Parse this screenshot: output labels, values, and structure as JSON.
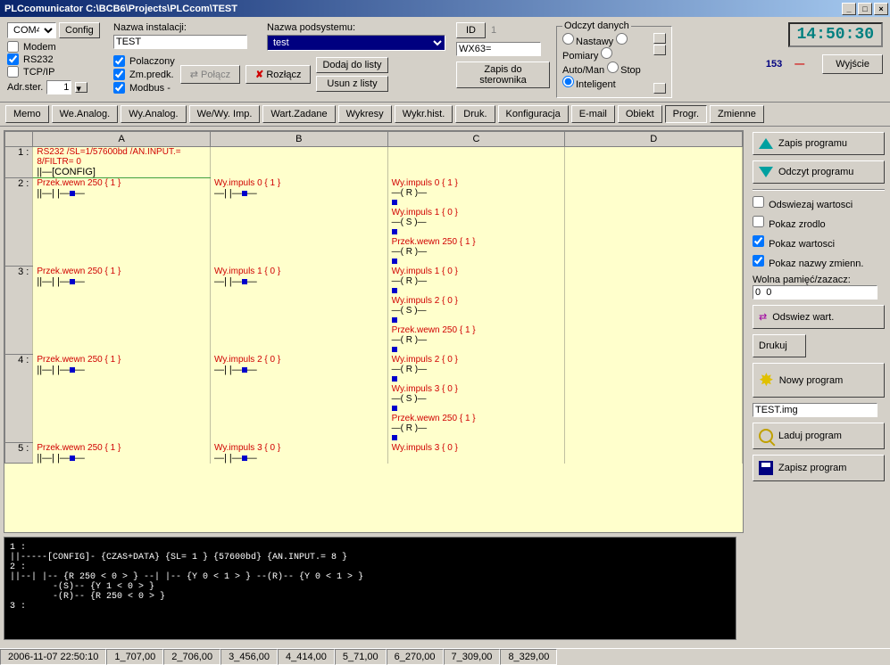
{
  "titlebar": {
    "title": "PLCcomunicator  C:\\BCB6\\Projects\\PLCcom\\TEST"
  },
  "port": {
    "value": "COM4",
    "config_btn": "Config"
  },
  "conn": {
    "modem": "Modem",
    "rs232": "RS232",
    "tcpip": "TCP/IP",
    "adr": "Adr.ster.",
    "adr_val": "1"
  },
  "install": {
    "label": "Nazwa instalacji:",
    "value": "TEST"
  },
  "subsys": {
    "label": "Nazwa podsystemu:",
    "value": "test"
  },
  "mid": {
    "polaczony": "Polaczony",
    "zmpredk": "Zm.predk.",
    "modbus": "Modbus -",
    "polacz": "Połącz",
    "rozlacz": "Rozłącz",
    "dodaj": "Dodaj do listy",
    "usun": "Usun z listy"
  },
  "idblock": {
    "id": "ID",
    "idval": "1",
    "wx": "WX63=",
    "zapis": "Zapis do sterownika"
  },
  "odczyt": {
    "legend": "Odczyt danych",
    "nastawy": "Nastawy",
    "pomiary": "Pomiary",
    "automan": "Auto/Man",
    "stop": "Stop",
    "inteligent": "Inteligent"
  },
  "topright": {
    "clock": "14:50:30",
    "num": "153",
    "dash": "—",
    "wyjscie": "Wyjście"
  },
  "tabs": [
    "Memo",
    "We.Analog.",
    "Wy.Analog.",
    "We/Wy. Imp.",
    "Wart.Zadane",
    "Wykresy",
    "Wykr.hist.",
    "Druk.",
    "Konfiguracja",
    "E-mail",
    "Obiekt",
    "Progr.",
    "Zmienne"
  ],
  "active_tab": 11,
  "cols": [
    "A",
    "B",
    "C",
    "D"
  ],
  "rows": [
    {
      "n": "1 :",
      "a": "RS232 /SL=1/57600bd /AN.INPUT.= 8/FILTR= 0",
      "a2": "[CONFIG]",
      "cfg": true
    },
    {
      "n": "2 :",
      "a": "Przek.wewn 250 { 1 }",
      "b": "Wy.impuls 0 { 1 }",
      "c": [
        "Wy.impuls 0 { 1 }",
        "—( R )—",
        "Wy.impuls 1 { 0 }",
        "—( S )—",
        "Przek.wewn 250 { 1 }",
        "—( R )—"
      ]
    },
    {
      "n": "3 :",
      "a": "Przek.wewn 250 { 1 }",
      "b": "Wy.impuls 1 { 0 }",
      "c": [
        "Wy.impuls 1 { 0 }",
        "—( R )—",
        "Wy.impuls 2 { 0 }",
        "—( S )—",
        "Przek.wewn 250 { 1 }",
        "—( R )—"
      ]
    },
    {
      "n": "4 :",
      "a": "Przek.wewn 250 { 1 }",
      "b": "Wy.impuls 2 { 0 }",
      "c": [
        "Wy.impuls 2 { 0 }",
        "—( R )—",
        "Wy.impuls 3 { 0 }",
        "—( S )—",
        "Przek.wewn 250 { 1 }",
        "—( R )—"
      ]
    },
    {
      "n": "5 :",
      "a": "Przek.wewn 250 { 1 }",
      "b": "Wy.impuls 3 { 0 }",
      "c": [
        "Wy.impuls 3 { 0 }"
      ]
    }
  ],
  "side": {
    "zapis_prog": "Zapis programu",
    "odczyt_prog": "Odczyt programu",
    "odswiezaj": "Odswiezaj wartosci",
    "pokaz_zrodlo": "Pokaz zrodlo",
    "pokaz_wart": "Pokaz wartosci",
    "pokaz_nazwy": "Pokaz nazwy zmienn.",
    "wolna": "Wolna pamięć/zazacz:",
    "wolna_val": "0  0",
    "odswiez": "Odswiez wart.",
    "drukuj": "Drukuj",
    "nowy": "Nowy program",
    "file": "TEST.img",
    "laduj": "Laduj program",
    "zapisz": "Zapisz program"
  },
  "console": "1 :\n||-----[CONFIG]- {CZAS+DATA} {SL= 1 } {57600bd} {AN.INPUT.= 8 }\n2 :\n||--| |-- {R 250 < 0 > } --| |-- {Y 0 < 1 > } --(R)-- {Y 0 < 1 > }\n        -(S)-- {Y 1 < 0 > }\n        -(R)-- {R 250 < 0 > }\n3 :",
  "status": [
    "2006-11-07 22:50:10",
    "1_707,00",
    "2_706,00",
    "3_456,00",
    "4_414,00",
    "5_71,00",
    "6_270,00",
    "7_309,00",
    "8_329,00"
  ]
}
